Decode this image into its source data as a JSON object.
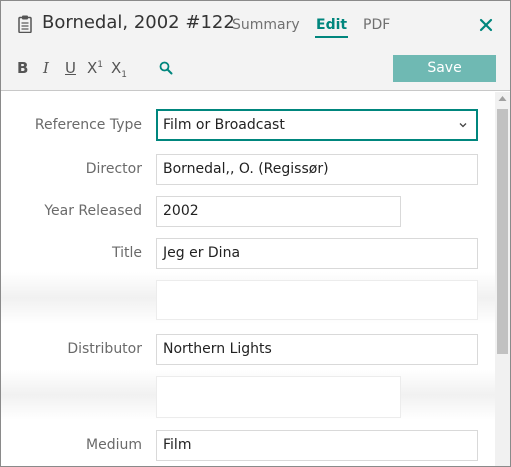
{
  "header": {
    "reference_title": "Bornedal, 2002 #122",
    "tabs": [
      {
        "label": "Summary"
      },
      {
        "label": "Edit"
      },
      {
        "label": "PDF"
      }
    ],
    "active_tab": "Edit",
    "close_icon": "close-icon",
    "doc_icon": "clipboard-icon"
  },
  "toolbar": {
    "bold": "B",
    "italic": "I",
    "underline": "U",
    "superscript_base": "X",
    "superscript_mark": "1",
    "subscript_base": "X",
    "subscript_mark": "1",
    "find_icon": "search-icon",
    "save_label": "Save"
  },
  "form": {
    "fields": [
      {
        "label": "Reference Type",
        "value": "Film or Broadcast"
      },
      {
        "label": "Director",
        "value": "Bornedal,, O. (Regissør)"
      },
      {
        "label": "Year Released",
        "value": "2002"
      },
      {
        "label": "Title",
        "value": "Jeg er Dina"
      },
      {
        "label": "Distributor",
        "value": "Northern Lights"
      },
      {
        "label": "Medium",
        "value": "Film"
      }
    ]
  },
  "colors": {
    "accent": "#00867d",
    "save_button": "#6fb9b3",
    "header_background": "#f3f3f3"
  }
}
